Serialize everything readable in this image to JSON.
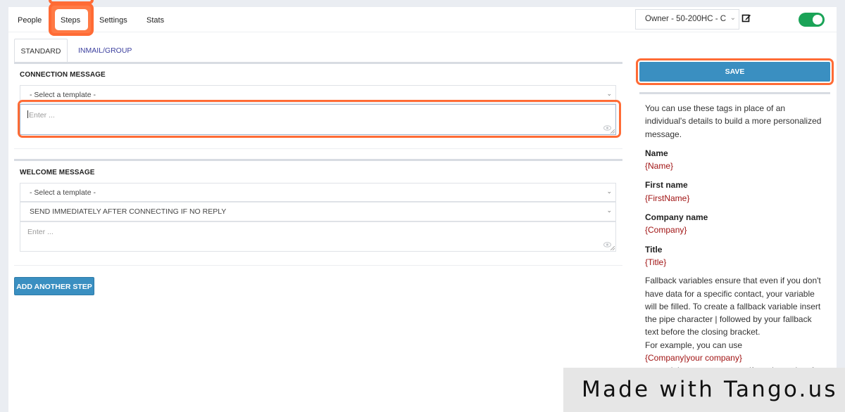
{
  "nav": {
    "items": [
      {
        "label": "People"
      },
      {
        "label": "Steps"
      },
      {
        "label": "Settings"
      },
      {
        "label": "Stats"
      }
    ],
    "active": "Steps",
    "owner_select": "Owner - 50-200HC - C",
    "toggle_on": true
  },
  "subtabs": {
    "standard": "STANDARD",
    "inmail": "INMAIL/GROUP"
  },
  "connection": {
    "title": "CONNECTION MESSAGE",
    "template_select": "- Select a template -",
    "message_placeholder": "Enter ..."
  },
  "welcome": {
    "title": "WELCOME MESSAGE",
    "template_select": "- Select a template -",
    "timing_select": "SEND IMMEDIATELY AFTER CONNECTING IF NO REPLY",
    "message_placeholder": "Enter ..."
  },
  "buttons": {
    "add_step": "ADD ANOTHER STEP",
    "save": "SAVE"
  },
  "help": {
    "intro": "You can use these tags in place of an individual's details to build a more personalized message.",
    "tags": [
      {
        "label": "Name",
        "value": "{Name}"
      },
      {
        "label": "First name",
        "value": "{FirstName}"
      },
      {
        "label": "Company name",
        "value": "{Company}"
      },
      {
        "label": "Title",
        "value": "{Title}"
      }
    ],
    "fallback": "Fallback variables ensure that even if you don't have data for a specific contact, your variable will be filled. To create a fallback variable insert the pipe character | followed by your fallback text before the closing bracket.",
    "example_intro": "For example, you can use",
    "example": "{Company|your company}",
    "example_after": "to send the company name if you have data for"
  },
  "colors": {
    "accent_blue": "#3a8fc1",
    "toggle_green": "#1aa357",
    "tag_red": "#a11414",
    "highlight_orange": "#ff6b35"
  },
  "watermark": "Made with Tango.us"
}
